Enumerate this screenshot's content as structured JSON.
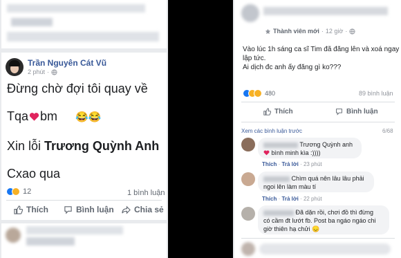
{
  "left_post": {
    "author": "Trần Nguyên Cát Vũ",
    "time": "2 phút",
    "privacy_icon": "globe-icon",
    "lines": [
      "Đừng chờ đợi tôi quay về",
      "Tqa",
      "bm",
      "Xin lỗi",
      "Trương Quỳnh Anh",
      "Cxao qua"
    ],
    "heart_emoji": "heart-icon",
    "laugh_emoji": "😂😂",
    "reaction_count": "12",
    "comment_count": "1 bình luận",
    "actions": {
      "like": "Thích",
      "comment": "Bình luận",
      "share": "Chia sẻ"
    }
  },
  "right_post": {
    "member_label": "Thành viên mới",
    "time": "12 giờ",
    "text_line1": "Vào lúc 1h sáng ca sĩ Tim đã đăng lên và xoá ngay",
    "text_line2": "lập tức.",
    "text_line3": "Ai dịch đc anh ấy đăng gì ko???",
    "reaction_count": "480",
    "comment_count": "89 bình luận",
    "actions": {
      "like": "Thích",
      "comment": "Bình luận"
    },
    "see_previous": "Xem các bình luận trước",
    "pager": "6/68",
    "comments": [
      {
        "text": "Trương Quỳnh anh",
        "text2": "bình minh kìa :))))",
        "like": "Thích",
        "reply": "Trả lời",
        "time": "23 phút"
      },
      {
        "text": "Chìm quá nên lâu lâu phải",
        "text2": "ngoi lên làm màu tí",
        "like": "Thích",
        "reply": "Trả lời",
        "time": "22 phút"
      },
      {
        "text": "Đã dặn rồi, chơi đồ thì đừng",
        "text2": "có cầm đt lướt fb. Post ba ngáo ngáo chi",
        "text3": "giờ thiên hạ chửi",
        "emoji": "😞"
      }
    ]
  },
  "colors": {
    "link": "#385898",
    "heart": "#e0245e",
    "like_blue": "#1877f2",
    "wow_yellow": "#f7b125"
  }
}
